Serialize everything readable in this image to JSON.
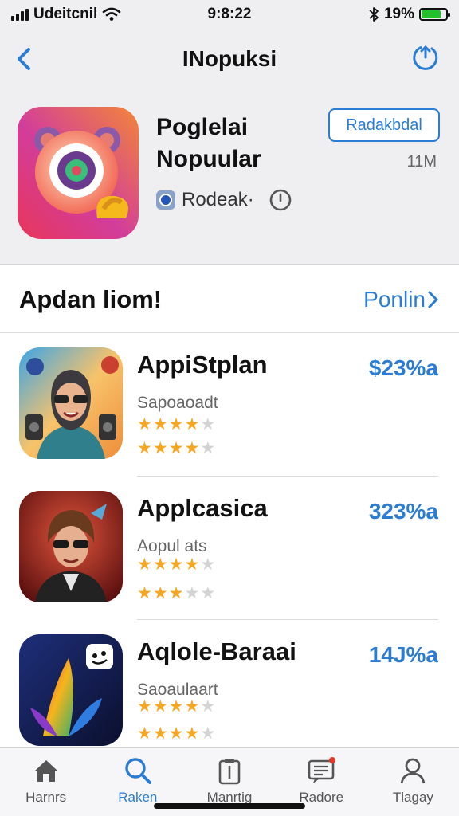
{
  "status_bar": {
    "carrier": "Udeitcnil",
    "time": "9:8:22",
    "battery_text": "19%",
    "battery_level": 0.8
  },
  "nav": {
    "title": "INopuksi",
    "back_icon": "chevron-left-icon",
    "refresh_icon": "refresh-icon"
  },
  "featured": {
    "title_line1": "Poglelai",
    "title_line2": "Nopuular",
    "action_label": "Radakbdal",
    "size_text": "11М",
    "developer": "Rodeak·"
  },
  "section": {
    "title": "Apdan liom!",
    "link_label": "Ponlin"
  },
  "apps": [
    {
      "name": "AppiStplan",
      "subtitle": "Sapoaoadt",
      "price": "$23%a",
      "rating1": 4,
      "rating2": 4
    },
    {
      "name": "Applcasica",
      "subtitle": "Aopul ats",
      "price": "323%a",
      "rating1": 4,
      "rating2": 3
    },
    {
      "name": "Aqlole-Baraai",
      "subtitle": "Saoaulaart",
      "price": "14J%a",
      "rating1": 4,
      "rating2": 4
    }
  ],
  "tabs": [
    {
      "label": "Harnrs",
      "icon": "home-icon"
    },
    {
      "label": "Raken",
      "icon": "search-icon"
    },
    {
      "label": "Manrtig",
      "icon": "clipboard-icon"
    },
    {
      "label": "Radore",
      "icon": "message-icon"
    },
    {
      "label": "Tlagay",
      "icon": "person-icon"
    }
  ],
  "colors": {
    "accent": "#2b7cd3",
    "star": "#f5a623",
    "battery": "#22c02a"
  }
}
